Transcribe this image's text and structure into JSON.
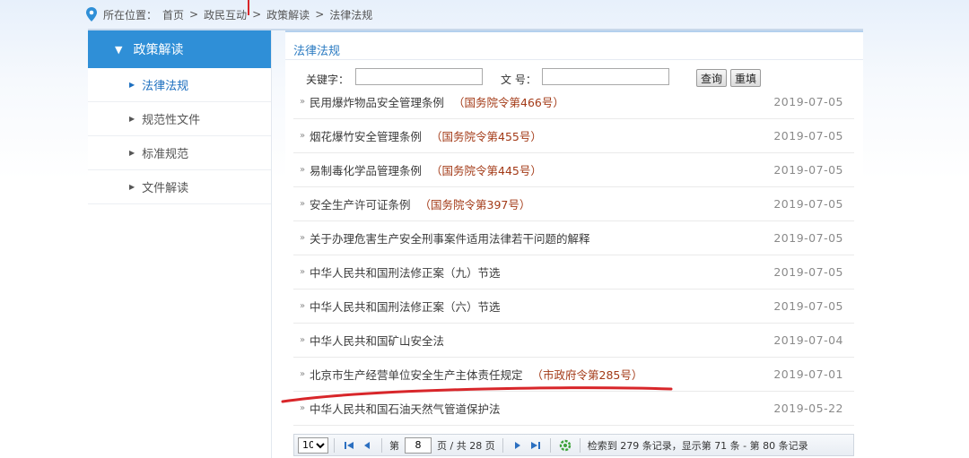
{
  "breadcrumb": {
    "prefix": "所在位置：",
    "items": [
      "首页",
      "政民互动",
      "政策解读",
      "法律法规"
    ],
    "separator": ">"
  },
  "sidebar": {
    "header": "政策解读",
    "items": [
      {
        "label": "法律法规",
        "active": true
      },
      {
        "label": "规范性文件",
        "active": false
      },
      {
        "label": "标准规范",
        "active": false
      },
      {
        "label": "文件解读",
        "active": false
      }
    ]
  },
  "content": {
    "title": "法律法规",
    "search": {
      "keyword_label": "关键字：",
      "keyword_value": "",
      "docno_label": "文  号：",
      "docno_value": "",
      "query_button": "查询",
      "reset_button": "重填"
    },
    "rows": [
      {
        "title": "民用爆炸物品安全管理条例",
        "order": "（国务院令第466号）",
        "date": "2019-07-05"
      },
      {
        "title": "烟花爆竹安全管理条例",
        "order": "（国务院令第455号）",
        "date": "2019-07-05"
      },
      {
        "title": "易制毒化学品管理条例",
        "order": "（国务院令第445号）",
        "date": "2019-07-05"
      },
      {
        "title": "安全生产许可证条例",
        "order": "（国务院令第397号）",
        "date": "2019-07-05"
      },
      {
        "title": "关于办理危害生产安全刑事案件适用法律若干问题的解释",
        "order": "",
        "date": "2019-07-05"
      },
      {
        "title": "中华人民共和国刑法修正案（九）节选",
        "order": "",
        "date": "2019-07-05"
      },
      {
        "title": "中华人民共和国刑法修正案（六）节选",
        "order": "",
        "date": "2019-07-05"
      },
      {
        "title": "中华人民共和国矿山安全法",
        "order": "",
        "date": "2019-07-04"
      },
      {
        "title": "北京市生产经营单位安全生产主体责任规定",
        "order": "（市政府令第285号）",
        "date": "2019-07-01"
      },
      {
        "title": "中华人民共和国石油天然气管道保护法",
        "order": "",
        "date": "2019-05-22"
      }
    ]
  },
  "pager": {
    "page_size": "10",
    "page_label_before": "第",
    "current_page": "8",
    "page_label_after": "页 / 共 28 页",
    "summary": "检索到 279 条记录，显示第 71 条 - 第 80 条记录"
  },
  "colors": {
    "accent": "#2f8fd7",
    "order_text": "#a33a17",
    "annotation": "#d8262a"
  },
  "icons": [
    "location-pin-icon",
    "triangle-down-icon",
    "bullet-icon",
    "first-page-icon",
    "prev-page-icon",
    "next-page-icon",
    "last-page-icon",
    "refresh-icon"
  ]
}
